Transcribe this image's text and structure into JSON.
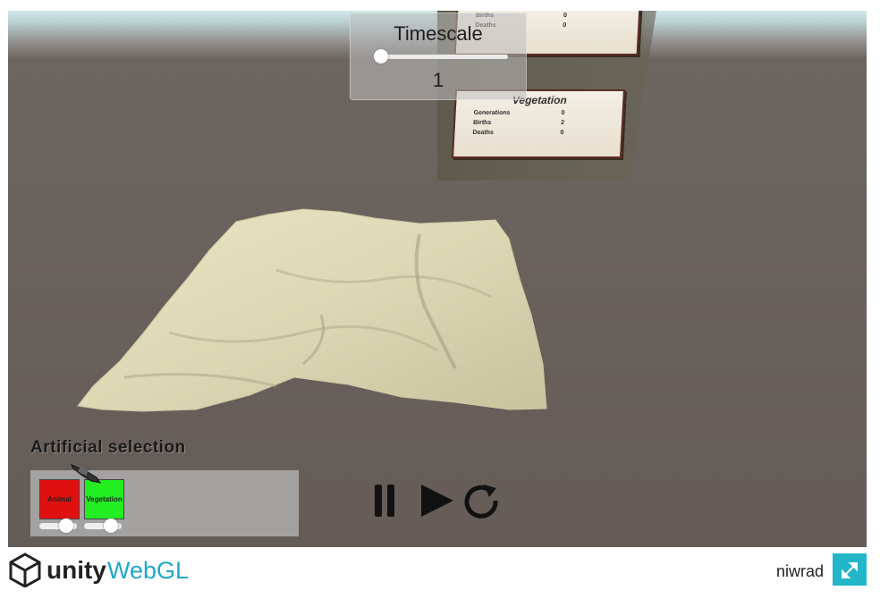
{
  "timescale": {
    "title": "Timescale",
    "value": "1",
    "slider_fraction": 0.0
  },
  "cards": {
    "top": {
      "rows": [
        {
          "label": "Births",
          "value": "0"
        },
        {
          "label": "Deaths",
          "value": "0"
        }
      ]
    },
    "vegetation": {
      "title": "Vegetation",
      "rows": [
        {
          "label": "Generations",
          "value": "0"
        },
        {
          "label": "Births",
          "value": "2"
        },
        {
          "label": "Deaths",
          "value": "0"
        }
      ]
    }
  },
  "selection": {
    "title": "Artificial selection",
    "animal_label": "Animal",
    "vegetation_label": "Vegetation",
    "animal_slider_fraction": 0.85,
    "vegetation_slider_fraction": 0.85
  },
  "controls": {
    "pause": "pause-icon",
    "play": "play-icon",
    "restart": "restart-icon"
  },
  "footer": {
    "brand": "unity",
    "brand_suffix": "WebGL",
    "username": "niwrad"
  },
  "colors": {
    "animal": "#e01010",
    "vegetation": "#22ee22",
    "fullscreen": "#22b6c8"
  }
}
